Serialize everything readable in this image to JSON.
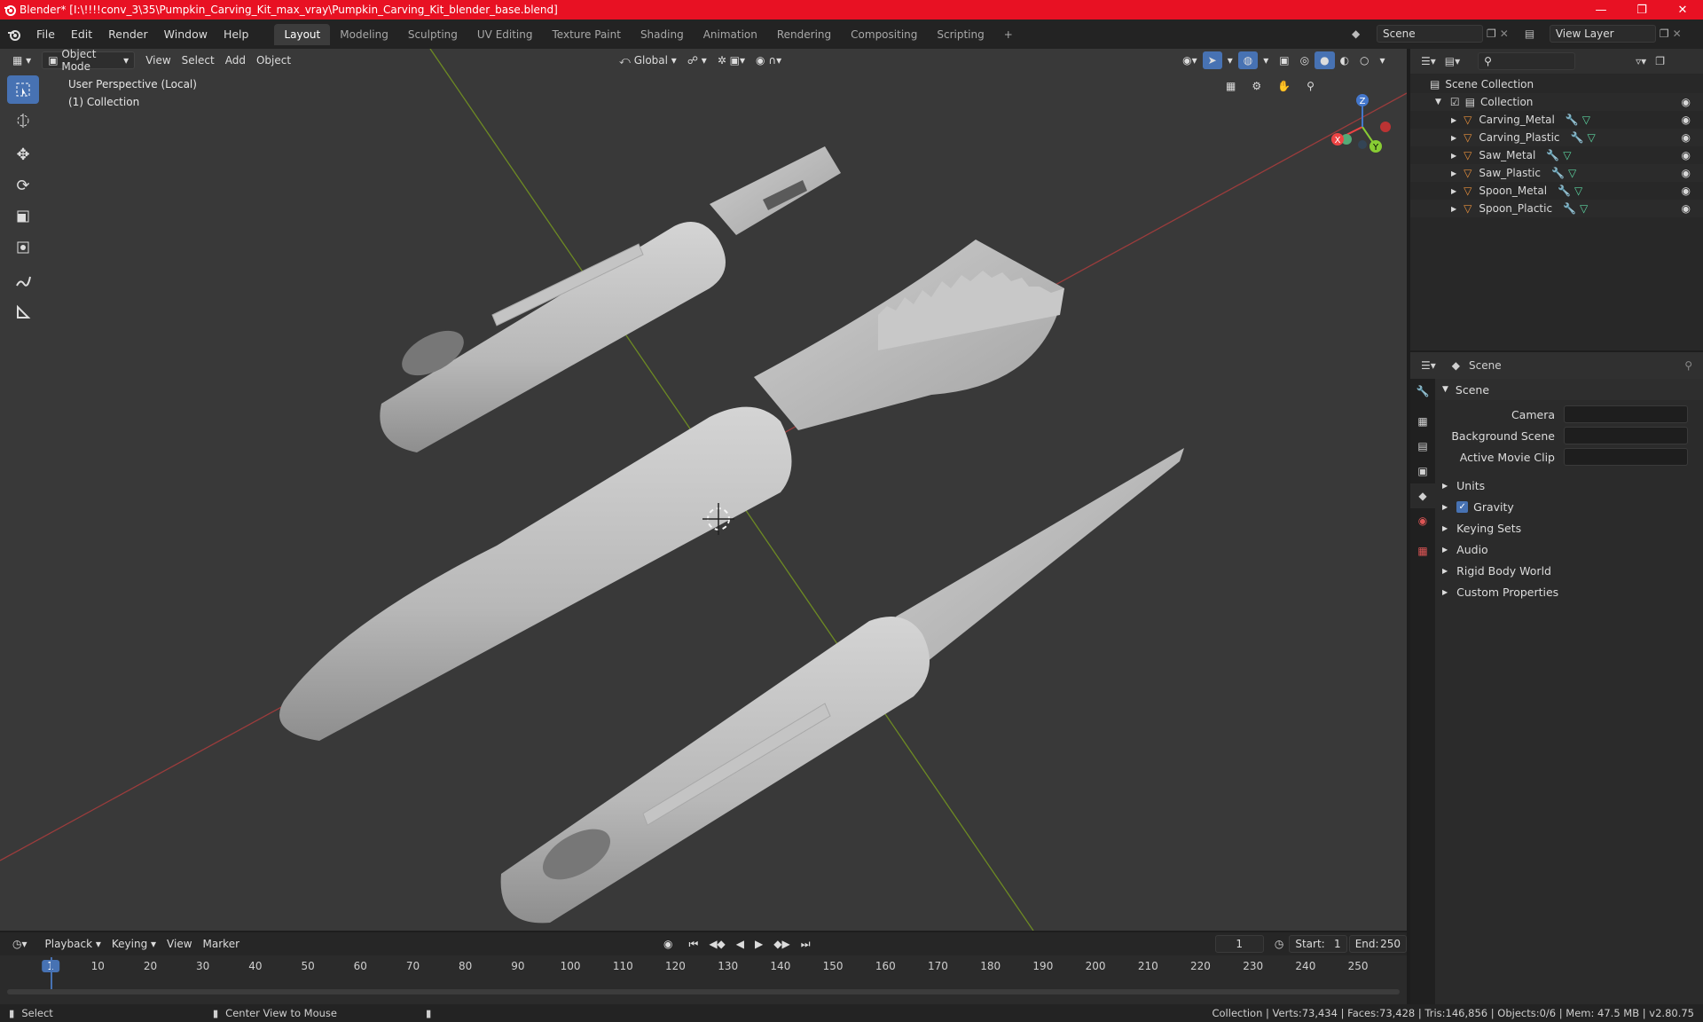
{
  "titlebar": {
    "title": "Blender* [I:\\!!!!conv_3\\35\\Pumpkin_Carving_Kit_max_vray\\Pumpkin_Carving_Kit_blender_base.blend]",
    "accent": "#e81123"
  },
  "menu": [
    "File",
    "Edit",
    "Render",
    "Window",
    "Help"
  ],
  "workspaces": [
    "Layout",
    "Modeling",
    "Sculpting",
    "UV Editing",
    "Texture Paint",
    "Shading",
    "Animation",
    "Rendering",
    "Compositing",
    "Scripting"
  ],
  "active_workspace": "Layout",
  "scene_field": "Scene",
  "view_layer_field": "View Layer",
  "viewport": {
    "mode": "Object Mode",
    "menus": [
      "View",
      "Select",
      "Add",
      "Object"
    ],
    "orientation": "Global",
    "info_line1": "User Perspective (Local)",
    "info_line2": "(1) Collection",
    "gizmo": {
      "x": "X",
      "y": "Y",
      "z": "Z"
    }
  },
  "outliner": {
    "root": "Scene Collection",
    "collection": "Collection",
    "objects": [
      "Carving_Metal",
      "Carving_Plastic",
      "Saw_Metal",
      "Saw_Plastic",
      "Spoon_Metal",
      "Spoon_Plactic"
    ]
  },
  "properties": {
    "header": "Scene",
    "section": "Scene",
    "camera_label": "Camera",
    "background_label": "Background Scene",
    "clip_label": "Active Movie Clip",
    "panels": [
      "Units",
      "Gravity",
      "Keying Sets",
      "Audio",
      "Rigid Body World",
      "Custom Properties"
    ]
  },
  "timeline": {
    "menus": [
      "Playback",
      "Keying",
      "View",
      "Marker"
    ],
    "current_frame": "1",
    "start_label": "Start:",
    "start": "1",
    "end_label": "End:",
    "end": "250",
    "ticks": [
      "1",
      "10",
      "20",
      "30",
      "40",
      "50",
      "60",
      "70",
      "80",
      "90",
      "100",
      "110",
      "120",
      "130",
      "140",
      "150",
      "160",
      "170",
      "180",
      "190",
      "200",
      "210",
      "220",
      "230",
      "240",
      "250"
    ]
  },
  "status": {
    "left": "Select",
    "middle": "Center View to Mouse",
    "right": "Collection | Verts:73,434 | Faces:73,428 | Tris:146,856 | Objects:0/6 | Mem: 47.5 MB | v2.80.75"
  }
}
